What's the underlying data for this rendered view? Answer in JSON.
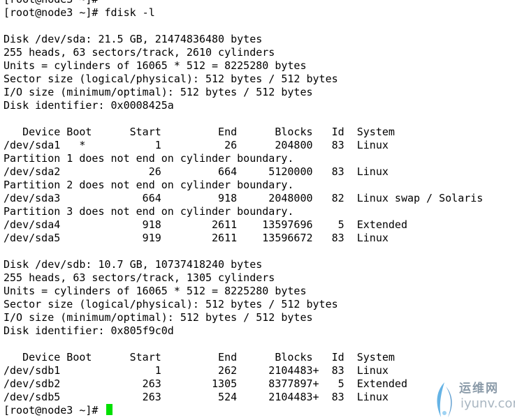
{
  "terminal": {
    "lines": [
      "[root@node3 ~]#",
      "[root@node3 ~]# fdisk -l",
      "",
      "Disk /dev/sda: 21.5 GB, 21474836480 bytes",
      "255 heads, 63 sectors/track, 2610 cylinders",
      "Units = cylinders of 16065 * 512 = 8225280 bytes",
      "Sector size (logical/physical): 512 bytes / 512 bytes",
      "I/O size (minimum/optimal): 512 bytes / 512 bytes",
      "Disk identifier: 0x0008425a",
      "",
      "   Device Boot      Start         End      Blocks   Id  System",
      "/dev/sda1   *           1          26      204800   83  Linux",
      "Partition 1 does not end on cylinder boundary.",
      "/dev/sda2              26         664     5120000   83  Linux",
      "Partition 2 does not end on cylinder boundary.",
      "/dev/sda3             664         918     2048000   82  Linux swap / Solaris",
      "Partition 3 does not end on cylinder boundary.",
      "/dev/sda4             918        2611    13597696    5  Extended",
      "/dev/sda5             919        2611    13596672   83  Linux",
      "",
      "Disk /dev/sdb: 10.7 GB, 10737418240 bytes",
      "255 heads, 63 sectors/track, 1305 cylinders",
      "Units = cylinders of 16065 * 512 = 8225280 bytes",
      "Sector size (logical/physical): 512 bytes / 512 bytes",
      "I/O size (minimum/optimal): 512 bytes / 512 bytes",
      "Disk identifier: 0x805f9c0d",
      "",
      "   Device Boot      Start         End      Blocks   Id  System",
      "/dev/sdb1               1         262     2104483+  83  Linux",
      "/dev/sdb2             263        1305     8377897+   5  Extended",
      "/dev/sdb5             263         524     2104483+  83  Linux"
    ],
    "prompt": "[root@node3 ~]# ",
    "cursor_color": "#00e000"
  },
  "watermark": {
    "cn_text": "运维网",
    "en_text": "iyunv.com",
    "icon": "iyunv-logo-icon"
  }
}
